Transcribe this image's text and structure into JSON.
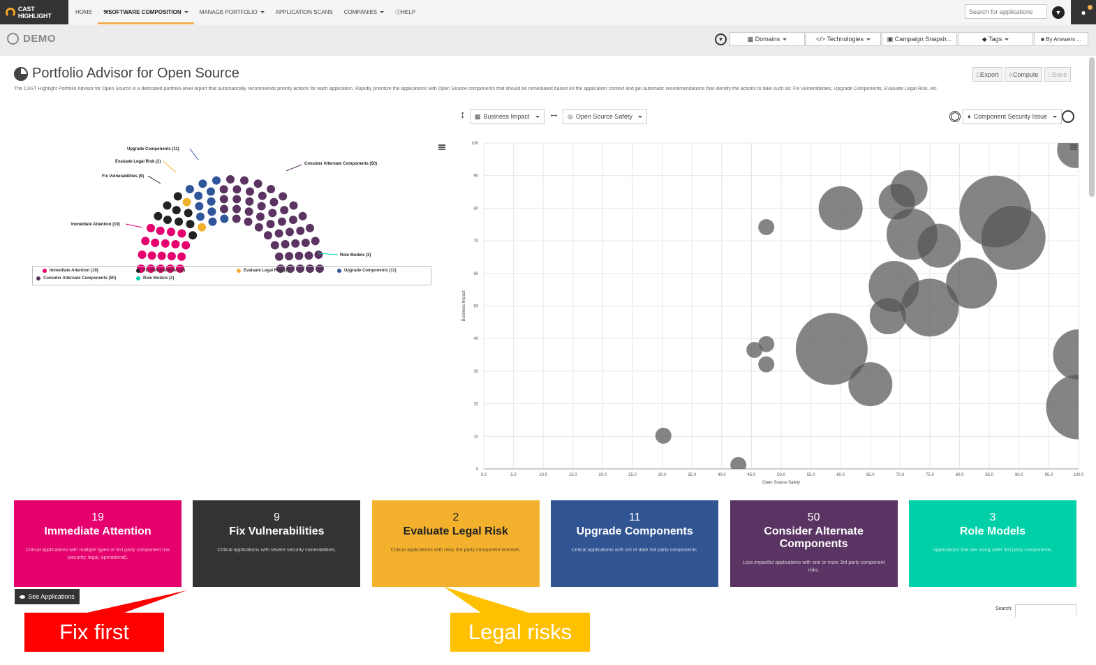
{
  "topbar": {
    "logo_text": "CAST HIGHLIGHT",
    "nav": [
      {
        "label": "HOME",
        "active": false,
        "caret": false
      },
      {
        "label": "SOFTWARE COMPOSITION",
        "active": true,
        "caret": true
      },
      {
        "label": "MANAGE PORTFOLIO",
        "active": false,
        "caret": true
      },
      {
        "label": "APPLICATION SCANS",
        "active": false,
        "caret": false
      },
      {
        "label": "COMPANIES",
        "active": false,
        "caret": true
      },
      {
        "label": "HELP",
        "active": false,
        "caret": false
      }
    ],
    "search_placeholder": "Search for applications",
    "filter_icon": "filter-icon",
    "user_icon": "user-icon"
  },
  "subbar": {
    "company": "DEMO",
    "filters": [
      "Domains",
      "Technologies",
      "Campaign Snapsh...",
      "Tags",
      "By Answers ..."
    ]
  },
  "page": {
    "title": "Portfolio Advisor for Open Source",
    "description": "The CAST Highlight Portfolio Advisor for Open Source is a dedicated portfolio-level report that automatically recommends priority actions for each application. Rapidly prioritize the applications with Open Source components that should be remediated based on the application context and get automatic recommendations that identify the actions to take such as: Fix Vulnerabilities, Upgrade Components, Evaluate Legal Risk, etc.",
    "actions": [
      "Export",
      "Compute",
      "Save"
    ]
  },
  "controls": {
    "y_axis": "Business Impact",
    "x_axis": "Open Source Safety",
    "size_metric": "Component Security Issue"
  },
  "parliament": {
    "labels": [
      {
        "name": "Upgrade Components (11)"
      },
      {
        "name": "Evaluate Legal Risk (2)"
      },
      {
        "name": "Fix Vulnerabilities (9)"
      },
      {
        "name": "Consider Alternate Components (50)"
      },
      {
        "name": "Immediate Attention (19)"
      },
      {
        "name": "Role Models (3)"
      }
    ],
    "legend": [
      {
        "label": "Immediate Attention (19)",
        "color": "#e6006e"
      },
      {
        "label": "Fix Vulnerabilities (9)",
        "color": "#222222"
      },
      {
        "label": "Evaluate Legal Risk (2)",
        "color": "#f0b22c"
      },
      {
        "label": "Upgrade Components (11)",
        "color": "#2f559a"
      },
      {
        "label": "Consider Alternate Components (50)",
        "color": "#5b3462"
      },
      {
        "label": "Role Models (2)",
        "color": "#00d0a8"
      }
    ]
  },
  "chart_data": {
    "type": "scatter",
    "title": "",
    "xlabel": "Open Source Safety",
    "ylabel": "Business Impact",
    "xlim": [
      0,
      100
    ],
    "ylim": [
      0,
      100
    ],
    "x_ticks": [
      "0.0",
      "5.0",
      "10.0",
      "15.0",
      "20.0",
      "25.0",
      "30.0",
      "35.0",
      "40.0",
      "45.0",
      "50.0",
      "55.0",
      "60.0",
      "65.0",
      "70.0",
      "75.0",
      "80.0",
      "85.0",
      "90.0",
      "95.0",
      "100.0"
    ],
    "y_ticks": [
      "0",
      "10",
      "20",
      "30",
      "40",
      "50",
      "60",
      "70",
      "80",
      "90",
      "100"
    ],
    "grid": true,
    "points": [
      {
        "x": 30.2,
        "y": 10.2,
        "size": 1
      },
      {
        "x": 42.8,
        "y": 1.2,
        "size": 1
      },
      {
        "x": 47.5,
        "y": 74.2,
        "size": 1
      },
      {
        "x": 45.5,
        "y": 36.5,
        "size": 1
      },
      {
        "x": 47.5,
        "y": 38.3,
        "size": 1
      },
      {
        "x": 47.5,
        "y": 32.1,
        "size": 1
      },
      {
        "x": 58.5,
        "y": 36.8,
        "size": 9
      },
      {
        "x": 65.0,
        "y": 26.0,
        "size": 5
      },
      {
        "x": 60.0,
        "y": 80.0,
        "size": 5
      },
      {
        "x": 71.5,
        "y": 86.0,
        "size": 4
      },
      {
        "x": 69.5,
        "y": 82.0,
        "size": 4
      },
      {
        "x": 72.0,
        "y": 72.0,
        "size": 6
      },
      {
        "x": 76.5,
        "y": 68.5,
        "size": 5
      },
      {
        "x": 69.0,
        "y": 56.0,
        "size": 6
      },
      {
        "x": 75.0,
        "y": 49.5,
        "size": 7
      },
      {
        "x": 68.0,
        "y": 47.0,
        "size": 4
      },
      {
        "x": 82.0,
        "y": 57.0,
        "size": 6
      },
      {
        "x": 86.0,
        "y": 79.0,
        "size": 9
      },
      {
        "x": 89.0,
        "y": 71.0,
        "size": 8
      },
      {
        "x": 99.5,
        "y": 98.0,
        "size": 4
      },
      {
        "x": 100.0,
        "y": 35.0,
        "size": 6
      },
      {
        "x": 100.0,
        "y": 19.0,
        "size": 8
      }
    ]
  },
  "cards": [
    {
      "count": "19",
      "title": "Immediate Attention",
      "desc": "Critical applications with multiple types of 3rd party component risk (security, legal, operational).",
      "color": "#e6006e"
    },
    {
      "count": "9",
      "title": "Fix Vulnerabilities",
      "desc": "Critical applications with severe security vulnerabilities.",
      "color": "#333333"
    },
    {
      "count": "2",
      "title": "Evaluate Legal Risk",
      "desc": "Critical applications with risky 3rd party component licenses.",
      "color": "#f3b12d"
    },
    {
      "count": "11",
      "title": "Upgrade Components",
      "desc": "Critical applications with out of date 3rd party components.",
      "color": "#315592"
    },
    {
      "count": "50",
      "title": "Consider Alternate Components",
      "desc": "Less impactful applications with one or more 3rd party component risks.",
      "color": "#5a3462"
    },
    {
      "count": "3",
      "title": "Role Models",
      "desc": "Applications that are using safer 3rd party components.",
      "color": "#00d0a8"
    }
  ],
  "footer": {
    "see_apps": "See Applications",
    "search_label": "Search:"
  },
  "callouts": [
    {
      "text": "Fix first",
      "color": "#ff0000"
    },
    {
      "text": "Legal risks",
      "color": "#ffc000"
    }
  ]
}
